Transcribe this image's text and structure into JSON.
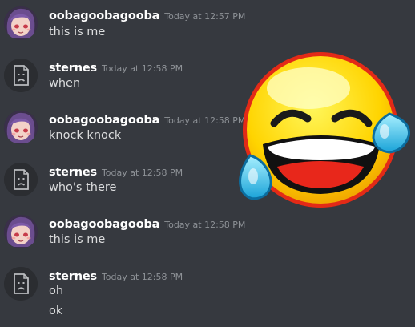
{
  "messages": [
    {
      "author": "oobagoobagooba",
      "timestamp": "Today at 12:57 PM",
      "lines": [
        "this is me"
      ]
    },
    {
      "author": "sternes",
      "timestamp": "Today at 12:58 PM",
      "lines": [
        "when"
      ]
    },
    {
      "author": "oobagoobagooba",
      "timestamp": "Today at 12:58 PM",
      "lines": [
        "knock knock"
      ]
    },
    {
      "author": "sternes",
      "timestamp": "Today at 12:58 PM",
      "lines": [
        "who's there"
      ]
    },
    {
      "author": "oobagoobagooba",
      "timestamp": "Today at 12:58 PM",
      "lines": [
        "this is me"
      ]
    },
    {
      "author": "sternes",
      "timestamp": "Today at 12:58 PM",
      "lines": [
        "oh",
        "ok"
      ]
    }
  ],
  "colors": {
    "background": "#36393f",
    "author": "#ffffff",
    "timestamp": "#8e9297",
    "text": "#dcddde"
  },
  "icons": {
    "sticker": "crying-laughing-emoji-icon",
    "default_avatar": "broken-file-face-icon",
    "user_avatar": "anime-girl-avatar-icon"
  }
}
